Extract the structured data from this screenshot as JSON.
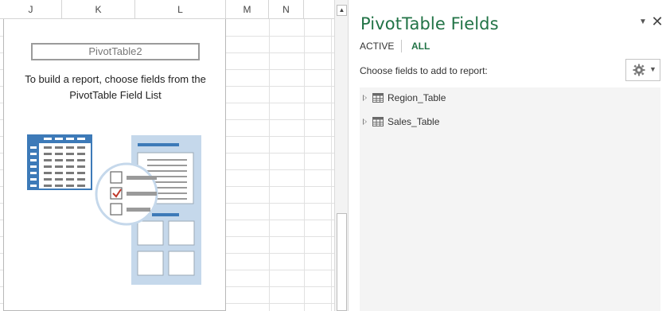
{
  "sheet": {
    "columns": [
      {
        "label": "J"
      },
      {
        "label": "K"
      },
      {
        "label": "L"
      },
      {
        "label": "M"
      },
      {
        "label": "N"
      }
    ],
    "pivot": {
      "name": "PivotTable2",
      "instructions_line1": "To build a report, choose fields from the",
      "instructions_line2": "PivotTable Field List"
    }
  },
  "pane": {
    "title": "PivotTable Fields",
    "tabs": {
      "active": "ACTIVE",
      "all": "ALL"
    },
    "choose_label": "Choose fields to add to report:",
    "settings_icon": "gear-icon",
    "fields": [
      {
        "label": "Region_Table",
        "icon": "table-icon"
      },
      {
        "label": "Sales_Table",
        "icon": "table-icon"
      }
    ]
  },
  "colors": {
    "accent": "#217346",
    "illustration_blue": "#3d7ab8",
    "illustration_light": "#c5d8eb",
    "check_red": "#c0392b"
  }
}
